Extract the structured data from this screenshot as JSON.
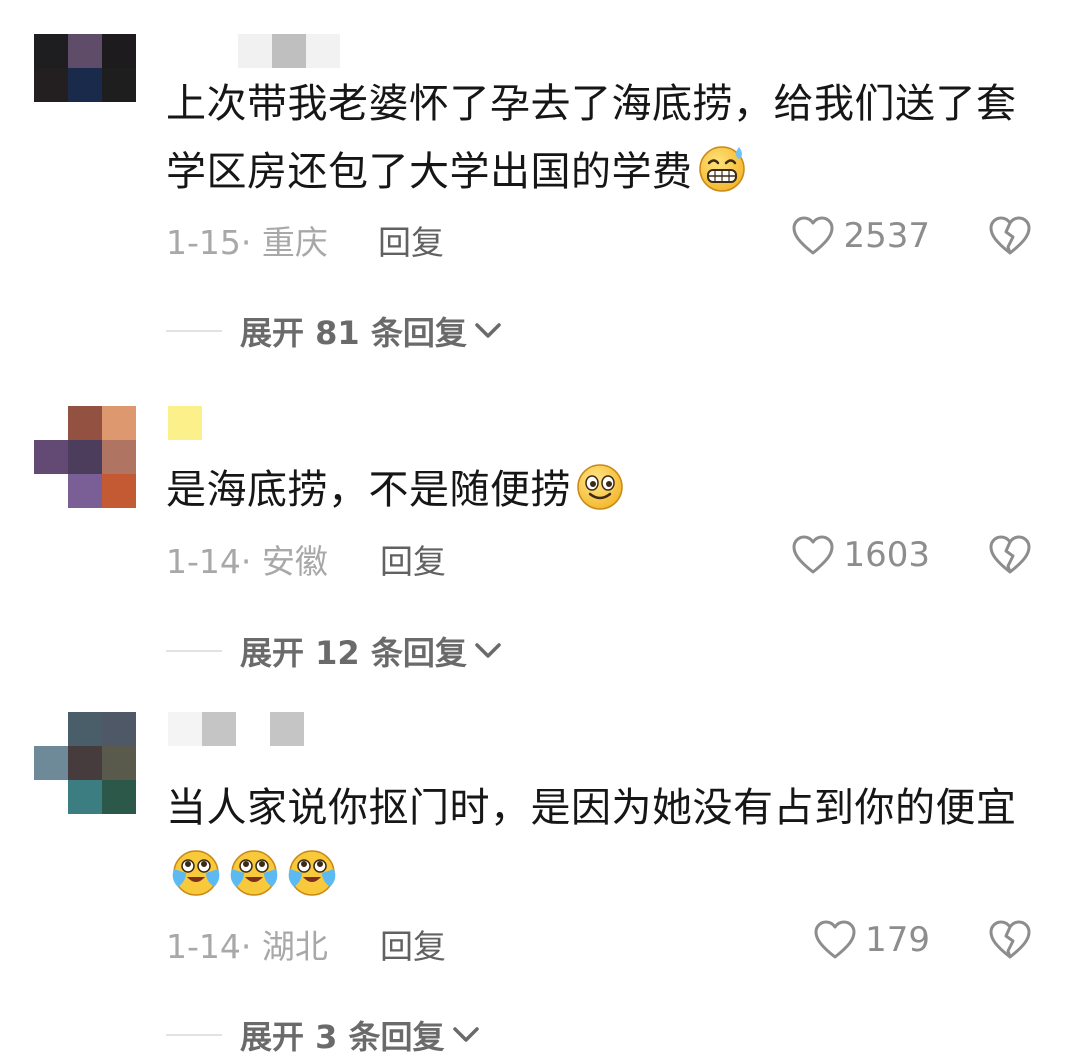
{
  "comments": [
    {
      "text": "上次带我老婆怀了孕去了海底捞，给我们送了套学区房还包了大学出国的学费",
      "emojis": [
        "grin-sweat-emoji"
      ],
      "date": "1-15·",
      "location": "重庆",
      "reply_label": "回复",
      "likes": "2537",
      "expand_label": "展开 81 条回复"
    },
    {
      "text": "是海底捞，不是随便捞",
      "emojis": [
        "smile-emoji"
      ],
      "date": "1-14·",
      "location": "安徽",
      "reply_label": "回复",
      "likes": "1603",
      "expand_label": "展开 12 条回复"
    },
    {
      "text": "当人家说你抠门时，是因为她没有占到你的便宜",
      "emojis": [
        "teary-laugh-emoji",
        "teary-laugh-emoji",
        "teary-laugh-emoji"
      ],
      "date": "1-14·",
      "location": "湖北",
      "reply_label": "回复",
      "likes": "179",
      "expand_label": "展开 3 条回复"
    }
  ],
  "colors": {
    "meta": "#a8a8a8",
    "reply": "#616161",
    "like": "#8d8d8d",
    "divider": "#e2e2e2"
  }
}
